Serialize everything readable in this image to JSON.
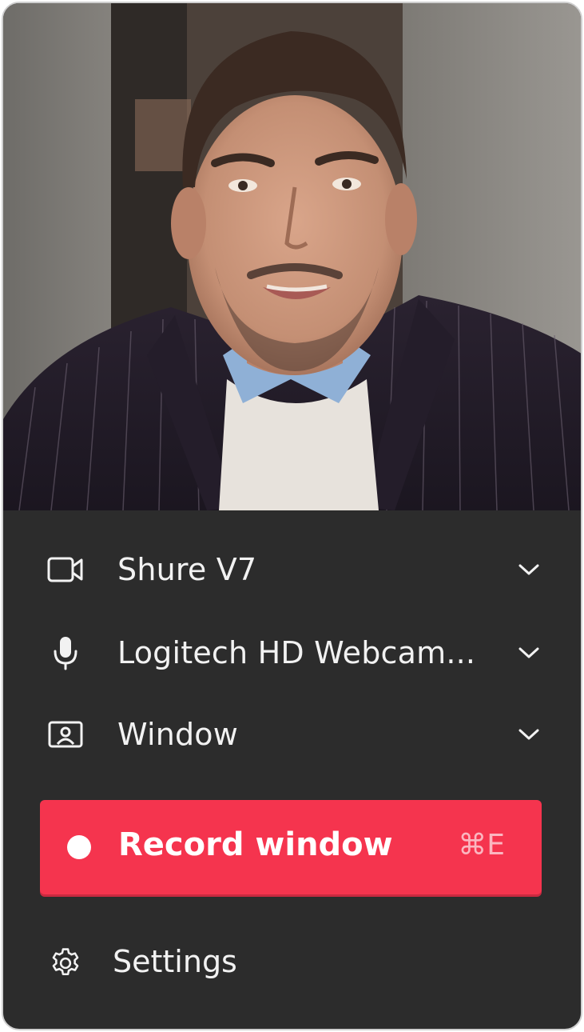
{
  "preview": {
    "description_icon": "webcam-preview"
  },
  "camera": {
    "label": "Shure V7",
    "icon": "video-camera-icon"
  },
  "microphone": {
    "label": "Logitech HD Webcam...",
    "icon": "microphone-icon"
  },
  "source": {
    "label": "Window",
    "icon": "window-capture-icon"
  },
  "record": {
    "label": "Record window",
    "shortcut": "⌘E",
    "color": "#f5344e"
  },
  "settings": {
    "label": "Settings",
    "icon": "gear-icon"
  },
  "colors": {
    "panel_bg": "#2c2c2c",
    "text": "#f2f2f2",
    "accent": "#f5344e"
  }
}
